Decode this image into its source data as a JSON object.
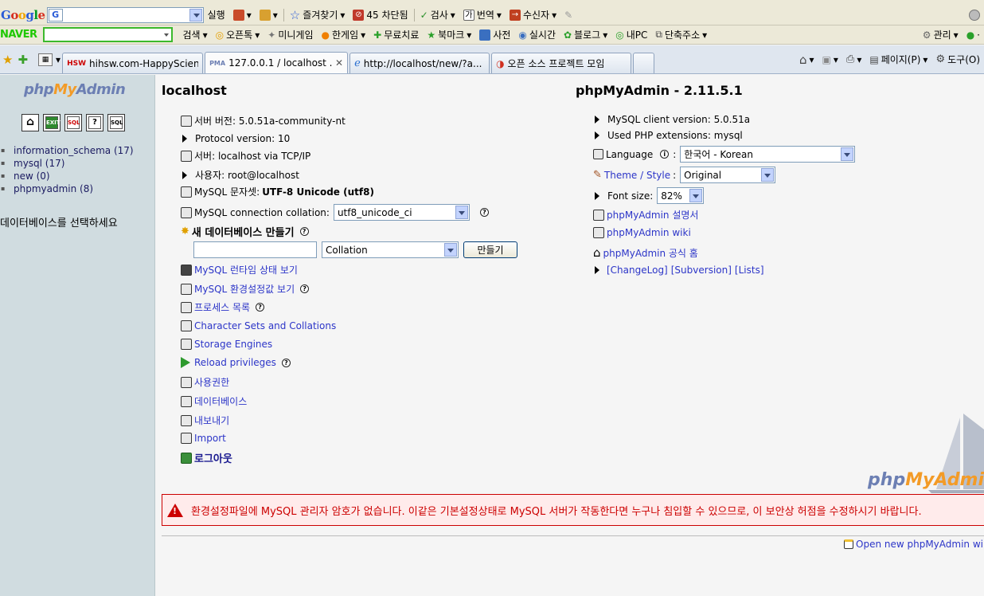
{
  "browser": {
    "google_toolbar": {
      "run_label": "실행",
      "favorites_label": "즐겨찾기",
      "blocked_label": "45 차단됨",
      "check_label": "검사",
      "translate_label": "번역",
      "receiver_label": "수신자"
    },
    "naver_toolbar": {
      "logo": "NAVER",
      "search_label": "검색",
      "items": [
        "오픈톡",
        "미니게임",
        "한게임",
        "무료치료",
        "북마크",
        "사전",
        "실시간",
        "블로그",
        "내PC",
        "단축주소"
      ],
      "manage_label": "관리"
    },
    "tabs": [
      {
        "title": "hihsw.com-HappyScien..."
      },
      {
        "title": "127.0.0.1 / localhost ..."
      },
      {
        "title": "http://localhost/new/?a..."
      },
      {
        "title": "오픈 소스 프로젝트 모임"
      }
    ],
    "page_menu": "페이지(P)",
    "tools_menu": "도구(O)"
  },
  "sidebar": {
    "logo": {
      "p1": "php",
      "p2": "My",
      "p3": "Admin"
    },
    "databases": [
      {
        "label": "information_schema (17)"
      },
      {
        "label": "mysql (17)"
      },
      {
        "label": "new (0)"
      },
      {
        "label": "phpmyadmin (8)"
      }
    ],
    "select_db_prompt": "데이터베이스를 선택하세요"
  },
  "main": {
    "server_title": "localhost",
    "server_version": "서버 버전: 5.0.51a-community-nt",
    "protocol_version": "Protocol version: 10",
    "server": "서버: localhost via TCP/IP",
    "user": "사용자: root@localhost",
    "charset_label": "MySQL 문자셋: ",
    "charset_value": "UTF-8 Unicode (utf8)",
    "collation_label": "MySQL connection collation:",
    "collation_value": "utf8_unicode_ci",
    "create_db_label": "새 데이터베이스 만들기",
    "create_collation_value": "Collation",
    "create_button": "만들기",
    "links": {
      "runtime": "MySQL 런타임 상태 보기",
      "variables": "MySQL 환경설정값 보기",
      "processes": "프로세스 목록",
      "charsets": "Character Sets and Collations",
      "engines": "Storage Engines",
      "reload": "Reload privileges",
      "privileges": "사용권한",
      "databases": "데이터베이스",
      "export": "내보내기",
      "import": "Import",
      "logout": "로그아웃"
    }
  },
  "right": {
    "title": "phpMyAdmin - 2.11.5.1",
    "client_version": "MySQL client version: 5.0.51a",
    "php_ext": "Used PHP extensions: mysql",
    "language_label": "Language",
    "language_value": "한국어 - Korean",
    "theme_label": "Theme / Style",
    "theme_value": "Original",
    "font_label": "Font size:",
    "font_value": "82%",
    "docs": "phpMyAdmin 설명서",
    "wiki": "phpMyAdmin wiki",
    "home": "phpMyAdmin 공식 홈",
    "changelog": "[ChangeLog]",
    "subversion": "[Subversion]",
    "lists": "[Lists]",
    "open_new": "Open new phpMyAdmin wi",
    "logo_big": {
      "p1": "php",
      "p2": "MyAdmi"
    }
  },
  "warning": "환경설정파일에 MySQL 관리자 암호가 없습니다. 이같은 기본설정상태로 MySQL 서버가 작동한다면 누구나 침입할 수 있으므로, 이 보안상 허점을 수정하시기 바랍니다."
}
